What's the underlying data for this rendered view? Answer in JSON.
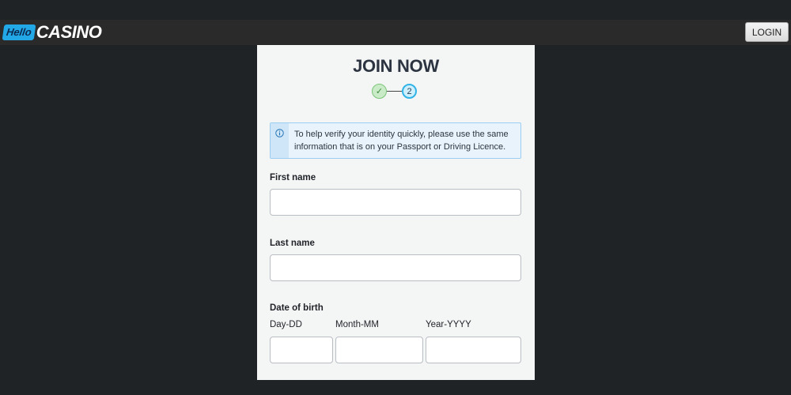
{
  "header": {
    "logo_hello": "Hello",
    "logo_casino": "CASINO",
    "login_label": "LOGIN"
  },
  "form": {
    "title": "JOIN NOW",
    "steps": [
      {
        "label": "✓",
        "state": "completed"
      },
      {
        "label": "2",
        "state": "current"
      }
    ],
    "info_text": "To help verify your identity quickly, please use the same information that is on your Passport or Driving Licence.",
    "first_name": {
      "label": "First name",
      "value": "",
      "placeholder": ""
    },
    "last_name": {
      "label": "Last name",
      "value": "",
      "placeholder": ""
    },
    "dob": {
      "label": "Date of birth",
      "day_label": "Day-DD",
      "month_label": "Month-MM",
      "year_label": "Year-YYYY"
    }
  },
  "colors": {
    "background": "#202326",
    "topbar": "#2a2a2a",
    "panel": "#f4f5f5",
    "accent": "#22a8e6",
    "info_border": "#9ccdf0"
  }
}
